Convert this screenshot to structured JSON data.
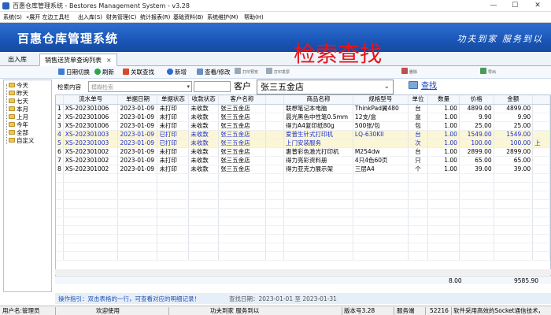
{
  "window": {
    "title": "百惠仓库管理系统 - Bestores Management System - v3.28",
    "min": "—",
    "max": "☐",
    "close": "✕"
  },
  "menu": [
    "系统(S)",
    "«展开 左边工具栏",
    "出入库(S)",
    "财务管理(C)",
    "统计报表(R)",
    "基础资料(B)",
    "系统维护(M)",
    "帮助(H)"
  ],
  "banner": {
    "brand": "百惠仓库管理系统",
    "slogan": "功夫到家 服务到以"
  },
  "tabs": [
    {
      "label": "出入库"
    },
    {
      "label": "销售送货单查询列表",
      "close": "×"
    }
  ],
  "toolbar": [
    "日期切换",
    "刷新",
    "关联查找",
    "新增",
    "查看/修改",
    "打印预览",
    "打印发票",
    "删除",
    "导出"
  ],
  "annotation": "检索查找",
  "tree": [
    "今天",
    "昨天",
    "七天",
    "本月",
    "上月",
    "今年",
    "全部",
    "自定义"
  ],
  "search": {
    "label": "检索内容",
    "placeholder": "模糊检索",
    "customer_label": "客户",
    "customer_value": "张三五金店",
    "button_label": "查找"
  },
  "grid": {
    "columns": [
      "",
      "流水单号",
      "单据日期",
      "单据状态",
      "收款状态",
      "客户名称",
      "",
      "商品名称",
      "规格型号",
      "单位",
      "数量",
      "价格",
      "金额",
      ""
    ],
    "rows": [
      {
        "n": "1",
        "no": "XS-202301006",
        "date": "2023-01-09",
        "doc": "未打印",
        "pay": "未收款",
        "cust": "张三五金店",
        "item": "联想笔记本电脑",
        "spec": "ThinkPad翼480",
        "unit": "台",
        "qty": "1.00",
        "price": "4899.00",
        "amt": "4899.00",
        "extra": ""
      },
      {
        "n": "2",
        "no": "XS-202301006",
        "date": "2023-01-09",
        "doc": "未打印",
        "pay": "未收款",
        "cust": "张三五金店",
        "item": "晨光黑色中性笔0.5mm",
        "spec": "12支/盒",
        "unit": "盒",
        "qty": "1.00",
        "price": "9.90",
        "amt": "9.90",
        "extra": ""
      },
      {
        "n": "3",
        "no": "XS-202301006",
        "date": "2023-01-09",
        "doc": "未打印",
        "pay": "未收款",
        "cust": "张三五金店",
        "item": "得力A4复印纸80g",
        "spec": "500张/包",
        "unit": "包",
        "qty": "1.00",
        "price": "25.00",
        "amt": "25.00",
        "extra": ""
      },
      {
        "n": "4",
        "no": "XS-202301003",
        "date": "2023-01-09",
        "doc": "已打印",
        "pay": "未收款",
        "cust": "张三五金店",
        "item": "爱普生针式打印机",
        "spec": "LQ-630KII",
        "unit": "台",
        "qty": "1.00",
        "price": "1549.00",
        "amt": "1549.00",
        "extra": "",
        "sel": true
      },
      {
        "n": "5",
        "no": "XS-202301003",
        "date": "2023-01-09",
        "doc": "已打印",
        "pay": "未收款",
        "cust": "张三五金店",
        "item": "上门安装服务",
        "spec": "",
        "unit": "次",
        "qty": "1.00",
        "price": "100.00",
        "amt": "100.00",
        "extra": "上",
        "sel": true
      },
      {
        "n": "6",
        "no": "XS-202301002",
        "date": "2023-01-09",
        "doc": "未打印",
        "pay": "未收款",
        "cust": "张三五金店",
        "item": "惠普彩色激光打印机",
        "spec": "M254dw",
        "unit": "台",
        "qty": "1.00",
        "price": "2899.00",
        "amt": "2899.00",
        "extra": ""
      },
      {
        "n": "7",
        "no": "XS-202301002",
        "date": "2023-01-09",
        "doc": "未打印",
        "pay": "未收款",
        "cust": "张三五金店",
        "item": "得力亮彩资料册",
        "spec": "4只4色60页",
        "unit": "只",
        "qty": "1.00",
        "price": "65.00",
        "amt": "65.00",
        "extra": ""
      },
      {
        "n": "8",
        "no": "XS-202301002",
        "date": "2023-01-09",
        "doc": "未打印",
        "pay": "未收款",
        "cust": "张三五金店",
        "item": "得力亚克力展示架",
        "spec": "三层A4",
        "unit": "个",
        "qty": "1.00",
        "price": "39.00",
        "amt": "39.00",
        "extra": ""
      }
    ],
    "totals": {
      "qty": "8.00",
      "amt": "9585.90"
    }
  },
  "hint": {
    "text": "操作指引：双击表格的一行，可查看对应的明细记录！",
    "range": "查找日期：2023-01-01 至 2023-01-31"
  },
  "status": {
    "user": "用户名:管理员",
    "welcome": "欢迎使用",
    "motto": "功夫到家 服务到以",
    "version": "版本号3.28",
    "service": "服务端",
    "port": "52216",
    "tech": "软件采用高效的Socket通信技术，"
  },
  "colors": {
    "banner": "#1a56b8",
    "annotation": "#e8141b",
    "selected_row_text": "#1a2fd0",
    "selected_row_bg": "#fbf6d6"
  }
}
